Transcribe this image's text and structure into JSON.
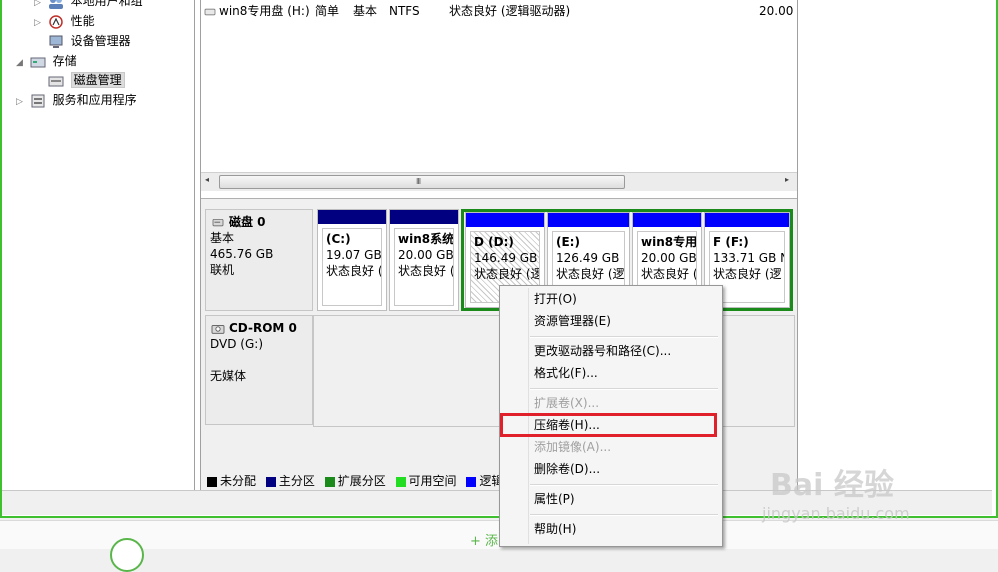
{
  "tree": {
    "items": [
      {
        "label": "本地用户和组",
        "expand": "▷"
      },
      {
        "label": "性能",
        "expand": "▷"
      },
      {
        "label": "设备管理器",
        "expand": ""
      },
      {
        "label": "存储",
        "expand": "◢"
      },
      {
        "label": "磁盘管理",
        "expand": ""
      },
      {
        "label": "服务和应用程序",
        "expand": "▷"
      }
    ]
  },
  "volume_row": {
    "name": "win8专用盘 (H:)",
    "layout": "简单",
    "type": "基本",
    "fs": "NTFS",
    "status": "状态良好 (逻辑驱动器)",
    "capacity": "20.00"
  },
  "scrollbar": {
    "grip": "III",
    "left_arrow": "◂",
    "right_arrow": "▸"
  },
  "disk0": {
    "title": "磁盘 0",
    "type": "基本",
    "size": "465.76 GB",
    "state": "联机",
    "partitions": [
      {
        "name": "(C:)",
        "size": "19.07 GB",
        "status": "状态良好 ("
      },
      {
        "name": "win8系统",
        "size": "20.00 GB",
        "status": "状态良好 ("
      },
      {
        "name": "D  (D:)",
        "size": "146.49 GB I",
        "status": "状态良好 (逻"
      },
      {
        "name": "(E:)",
        "size": "126.49 GB N",
        "status": "状态良好 (逻"
      },
      {
        "name": "win8专用i",
        "size": "20.00 GB",
        "status": "状态良好 (逻"
      },
      {
        "name": "F  (F:)",
        "size": "133.71 GB N",
        "status": "状态良好 (逻"
      }
    ]
  },
  "cdrom": {
    "title": "CD-ROM 0",
    "drive": "DVD (G:)",
    "media": "无媒体"
  },
  "legend": [
    {
      "label": "未分配",
      "color": "#000000"
    },
    {
      "label": "主分区",
      "color": "#000080"
    },
    {
      "label": "扩展分区",
      "color": "#1a8a1a"
    },
    {
      "label": "可用空间",
      "color": "#22dd22"
    },
    {
      "label": "逻辑",
      "color": "#0000ff"
    }
  ],
  "context_menu": {
    "items": [
      {
        "label": "打开(O)",
        "enabled": true
      },
      {
        "label": "资源管理器(E)",
        "enabled": true
      },
      {
        "label": "更改驱动器号和路径(C)...",
        "enabled": true
      },
      {
        "label": "格式化(F)...",
        "enabled": true
      },
      {
        "label": "扩展卷(X)...",
        "enabled": false
      },
      {
        "label": "压缩卷(H)...",
        "enabled": true
      },
      {
        "label": "添加镜像(A)...",
        "enabled": false
      },
      {
        "label": "删除卷(D)...",
        "enabled": true
      },
      {
        "label": "属性(P)",
        "enabled": true
      },
      {
        "label": "帮助(H)",
        "enabled": true
      }
    ]
  },
  "bottom": {
    "add_label": "+ 添"
  },
  "watermark": {
    "brand": "Bai 经验",
    "url": "jingyan.baidu.com"
  },
  "colors": {
    "frame": "#3fc12f",
    "primary": "#000080",
    "logical": "#0000ff",
    "extended": "#1a8a1a",
    "highlight": "#e0202a"
  }
}
